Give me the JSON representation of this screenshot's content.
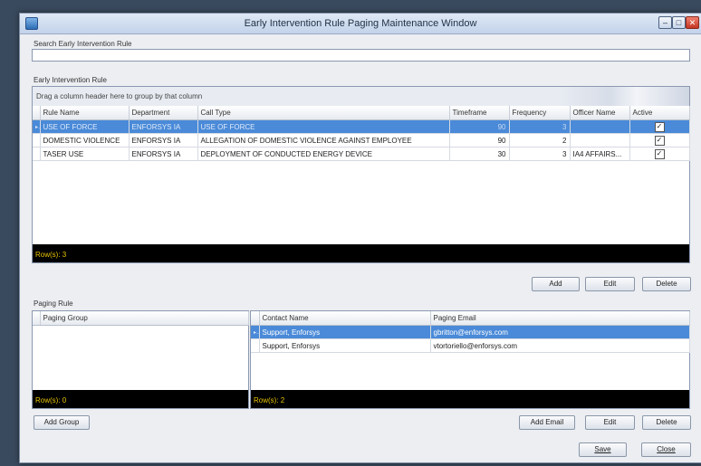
{
  "window": {
    "title": "Early Intervention Rule Paging Maintenance Window"
  },
  "search": {
    "label": "Search Early Intervention Rule",
    "value": ""
  },
  "rules": {
    "label": "Early Intervention Rule",
    "group_hint": "Drag a column header here to group by that column",
    "columns": [
      "Rule Name",
      "Department",
      "Call Type",
      "Timeframe",
      "Frequency",
      "Officer Name",
      "Active"
    ],
    "rows": [
      {
        "rule_name": "USE OF FORCE",
        "department": "ENFORSYS IA",
        "call_type": "USE OF FORCE",
        "timeframe": "90",
        "frequency": "3",
        "officer_name": "",
        "active": true,
        "selected": true
      },
      {
        "rule_name": "DOMESTIC VIOLENCE",
        "department": "ENFORSYS IA",
        "call_type": "ALLEGATION OF DOMESTIC VIOLENCE AGAINST EMPLOYEE",
        "timeframe": "90",
        "frequency": "2",
        "officer_name": "",
        "active": true,
        "selected": false
      },
      {
        "rule_name": "TASER USE",
        "department": "ENFORSYS IA",
        "call_type": "DEPLOYMENT OF CONDUCTED ENERGY DEVICE",
        "timeframe": "30",
        "frequency": "3",
        "officer_name": "IA4 AFFAIRS...",
        "active": true,
        "selected": false
      }
    ],
    "row_count": "Row(s): 3",
    "buttons": {
      "add": "Add",
      "edit": "Edit",
      "delete": "Delete"
    }
  },
  "paging": {
    "label": "Paging Rule",
    "group_column": "Paging Group",
    "group_row_count": "Row(s): 0",
    "contact_columns": [
      "Contact Name",
      "Paging Email"
    ],
    "contacts": [
      {
        "name": "Support, Enforsys",
        "email": "gbritton@enforsys.com",
        "selected": true
      },
      {
        "name": "Support, Enforsys",
        "email": "vtortoriello@enforsys.com",
        "selected": false
      }
    ],
    "contact_row_count": "Row(s): 2",
    "buttons": {
      "add_group": "Add Group",
      "add_email": "Add Email",
      "edit": "Edit",
      "delete": "Delete"
    }
  },
  "footer": {
    "save": "Save",
    "close": "Close"
  },
  "icons": {
    "row_indicator": "row-pointer-icon",
    "active_check": "checkbox-checked-icon"
  }
}
